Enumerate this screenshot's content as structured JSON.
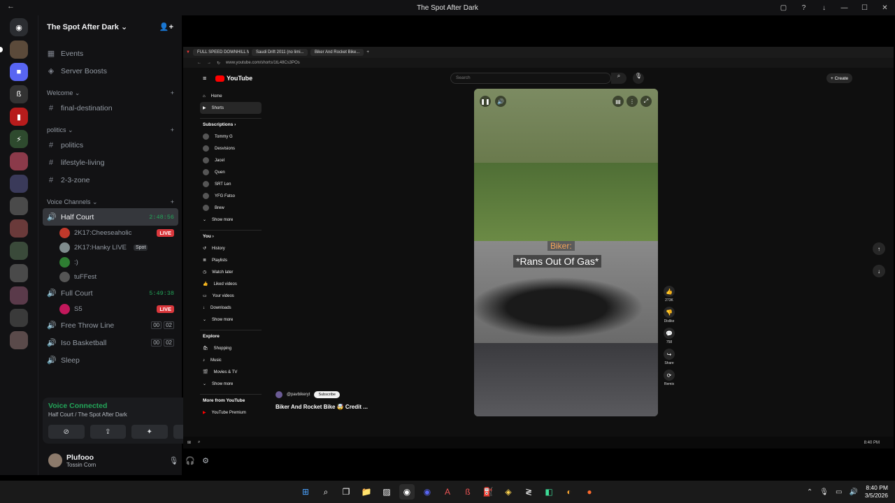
{
  "window": {
    "title": "The Spot After Dark"
  },
  "server": {
    "name": "The Spot After Dark"
  },
  "sidebar": {
    "top_items": [
      {
        "label": "Events"
      },
      {
        "label": "Server Boosts"
      }
    ],
    "categories": [
      {
        "label": "Welcome",
        "channels": [
          {
            "label": "final-destination"
          }
        ]
      },
      {
        "label": "politics",
        "channels": [
          {
            "label": "politics"
          },
          {
            "label": "lifestyle-living"
          },
          {
            "label": "2-3-zone"
          }
        ]
      }
    ],
    "voice_category": "Voice Channels",
    "voice": [
      {
        "label": "Half Court",
        "time": "2:48:56",
        "users": [
          {
            "name": "2K17:Cheeseaholic",
            "badge": "LIVE"
          },
          {
            "name": "2K17:Hanky LIVE",
            "tag": "Spot"
          },
          {
            "name": ":)"
          },
          {
            "name": "tuFFest"
          }
        ]
      },
      {
        "label": "Full Court",
        "time": "5:49:38",
        "users": [
          {
            "name": "S5",
            "badge": "LIVE"
          }
        ]
      },
      {
        "label": "Free Throw Line",
        "count_a": "00",
        "count_b": "02"
      },
      {
        "label": "Iso Basketball",
        "count_a": "00",
        "count_b": "02"
      },
      {
        "label": "Sleep"
      }
    ]
  },
  "voice_panel": {
    "status": "Voice Connected",
    "location": "Half Court / The Spot After Dark"
  },
  "user_panel": {
    "name": "Plufooo",
    "status": "Tossin Corn"
  },
  "browser": {
    "tabs": [
      "FULL SPEED DOWNHILL M...",
      "Saudi Drift 2011 (no limi...",
      "Biker And Rocket Bike..."
    ],
    "url": "www.youtube.com/shorts/1tL48Cs3POs"
  },
  "youtube": {
    "logo": "YouTube",
    "search_placeholder": "Search",
    "create_label": "Create",
    "nav": [
      {
        "label": "Home"
      },
      {
        "label": "Shorts"
      }
    ],
    "subscriptions_label": "Subscriptions",
    "subscriptions": [
      "Tommy G",
      "Desvisions",
      "Jacel",
      "Quen",
      "SRT Len",
      "YFG Fatso",
      "Brew",
      "Show more"
    ],
    "you_label": "You",
    "you_items": [
      "History",
      "Playlists",
      "Watch later",
      "Liked videos",
      "Your videos",
      "Downloads",
      "Show more"
    ],
    "explore_label": "Explore",
    "explore_items": [
      "Shopping",
      "Music",
      "Movies & TV",
      "Show more"
    ],
    "more_label": "More from YouTube",
    "more_items": [
      "YouTube Premium"
    ],
    "short": {
      "caption_top": "Biker:",
      "caption_main": "*Rans Out Of Gas*",
      "channel": "@pavbikeryt",
      "subscribe_label": "Subscribe",
      "title": "Biker And Rocket Bike 🤯 Credit ..."
    },
    "actions": [
      {
        "icon": "like-icon",
        "label": "273K"
      },
      {
        "icon": "dislike-icon",
        "label": "Dislike"
      },
      {
        "icon": "comment-icon",
        "label": "758"
      },
      {
        "icon": "share-icon",
        "label": "Share"
      },
      {
        "icon": "remix-icon",
        "label": "Remix"
      }
    ]
  },
  "inner_clock": "8:40 PM",
  "taskbar": {
    "time": "8:40 PM",
    "date": "3/5/2026"
  }
}
